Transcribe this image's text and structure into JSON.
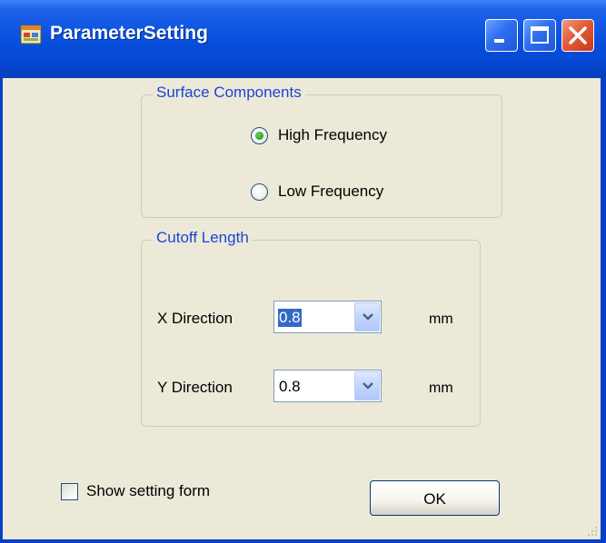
{
  "window": {
    "title": "ParameterSetting",
    "controls": [
      "minimize-icon",
      "maximize-icon",
      "close-icon"
    ]
  },
  "surface_components": {
    "title": "Surface Components",
    "options": [
      {
        "label": "High Frequency",
        "checked": true
      },
      {
        "label": "Low Frequency",
        "checked": false
      }
    ]
  },
  "cutoff_length": {
    "title": "Cutoff Length",
    "x": {
      "label": "X Direction",
      "value": "0.8",
      "unit": "mm"
    },
    "y": {
      "label": "Y Direction",
      "value": "0.8",
      "unit": "mm"
    }
  },
  "footer": {
    "show_setting_label": "Show setting form",
    "show_setting_checked": false,
    "ok_label": "OK"
  },
  "colors": {
    "titlebar": "#0a52e0",
    "client_bg": "#ece9d8",
    "group_title": "#1a45d6",
    "selection": "#316ac5",
    "radio_dot": "#2f9a29",
    "close_button": "#e25b35"
  }
}
